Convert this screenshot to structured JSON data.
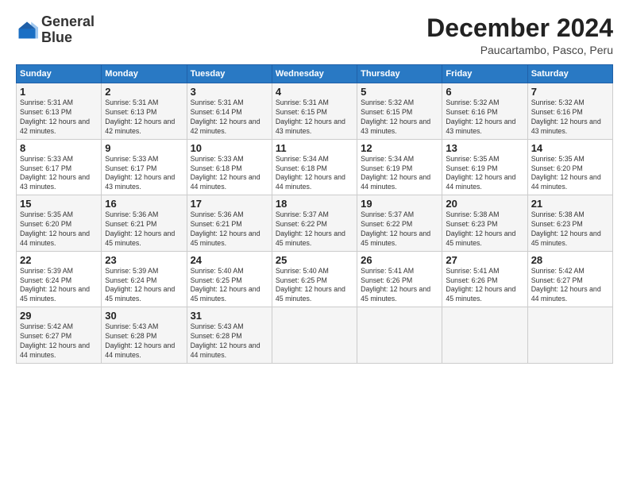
{
  "logo": {
    "line1": "General",
    "line2": "Blue"
  },
  "title": "December 2024",
  "subtitle": "Paucartambo, Pasco, Peru",
  "days_header": [
    "Sunday",
    "Monday",
    "Tuesday",
    "Wednesday",
    "Thursday",
    "Friday",
    "Saturday"
  ],
  "weeks": [
    [
      {
        "day": "1",
        "sunrise": "Sunrise: 5:31 AM",
        "sunset": "Sunset: 6:13 PM",
        "daylight": "Daylight: 12 hours and 42 minutes."
      },
      {
        "day": "2",
        "sunrise": "Sunrise: 5:31 AM",
        "sunset": "Sunset: 6:13 PM",
        "daylight": "Daylight: 12 hours and 42 minutes."
      },
      {
        "day": "3",
        "sunrise": "Sunrise: 5:31 AM",
        "sunset": "Sunset: 6:14 PM",
        "daylight": "Daylight: 12 hours and 42 minutes."
      },
      {
        "day": "4",
        "sunrise": "Sunrise: 5:31 AM",
        "sunset": "Sunset: 6:15 PM",
        "daylight": "Daylight: 12 hours and 43 minutes."
      },
      {
        "day": "5",
        "sunrise": "Sunrise: 5:32 AM",
        "sunset": "Sunset: 6:15 PM",
        "daylight": "Daylight: 12 hours and 43 minutes."
      },
      {
        "day": "6",
        "sunrise": "Sunrise: 5:32 AM",
        "sunset": "Sunset: 6:16 PM",
        "daylight": "Daylight: 12 hours and 43 minutes."
      },
      {
        "day": "7",
        "sunrise": "Sunrise: 5:32 AM",
        "sunset": "Sunset: 6:16 PM",
        "daylight": "Daylight: 12 hours and 43 minutes."
      }
    ],
    [
      {
        "day": "8",
        "sunrise": "Sunrise: 5:33 AM",
        "sunset": "Sunset: 6:17 PM",
        "daylight": "Daylight: 12 hours and 43 minutes."
      },
      {
        "day": "9",
        "sunrise": "Sunrise: 5:33 AM",
        "sunset": "Sunset: 6:17 PM",
        "daylight": "Daylight: 12 hours and 43 minutes."
      },
      {
        "day": "10",
        "sunrise": "Sunrise: 5:33 AM",
        "sunset": "Sunset: 6:18 PM",
        "daylight": "Daylight: 12 hours and 44 minutes."
      },
      {
        "day": "11",
        "sunrise": "Sunrise: 5:34 AM",
        "sunset": "Sunset: 6:18 PM",
        "daylight": "Daylight: 12 hours and 44 minutes."
      },
      {
        "day": "12",
        "sunrise": "Sunrise: 5:34 AM",
        "sunset": "Sunset: 6:19 PM",
        "daylight": "Daylight: 12 hours and 44 minutes."
      },
      {
        "day": "13",
        "sunrise": "Sunrise: 5:35 AM",
        "sunset": "Sunset: 6:19 PM",
        "daylight": "Daylight: 12 hours and 44 minutes."
      },
      {
        "day": "14",
        "sunrise": "Sunrise: 5:35 AM",
        "sunset": "Sunset: 6:20 PM",
        "daylight": "Daylight: 12 hours and 44 minutes."
      }
    ],
    [
      {
        "day": "15",
        "sunrise": "Sunrise: 5:35 AM",
        "sunset": "Sunset: 6:20 PM",
        "daylight": "Daylight: 12 hours and 44 minutes."
      },
      {
        "day": "16",
        "sunrise": "Sunrise: 5:36 AM",
        "sunset": "Sunset: 6:21 PM",
        "daylight": "Daylight: 12 hours and 45 minutes."
      },
      {
        "day": "17",
        "sunrise": "Sunrise: 5:36 AM",
        "sunset": "Sunset: 6:21 PM",
        "daylight": "Daylight: 12 hours and 45 minutes."
      },
      {
        "day": "18",
        "sunrise": "Sunrise: 5:37 AM",
        "sunset": "Sunset: 6:22 PM",
        "daylight": "Daylight: 12 hours and 45 minutes."
      },
      {
        "day": "19",
        "sunrise": "Sunrise: 5:37 AM",
        "sunset": "Sunset: 6:22 PM",
        "daylight": "Daylight: 12 hours and 45 minutes."
      },
      {
        "day": "20",
        "sunrise": "Sunrise: 5:38 AM",
        "sunset": "Sunset: 6:23 PM",
        "daylight": "Daylight: 12 hours and 45 minutes."
      },
      {
        "day": "21",
        "sunrise": "Sunrise: 5:38 AM",
        "sunset": "Sunset: 6:23 PM",
        "daylight": "Daylight: 12 hours and 45 minutes."
      }
    ],
    [
      {
        "day": "22",
        "sunrise": "Sunrise: 5:39 AM",
        "sunset": "Sunset: 6:24 PM",
        "daylight": "Daylight: 12 hours and 45 minutes."
      },
      {
        "day": "23",
        "sunrise": "Sunrise: 5:39 AM",
        "sunset": "Sunset: 6:24 PM",
        "daylight": "Daylight: 12 hours and 45 minutes."
      },
      {
        "day": "24",
        "sunrise": "Sunrise: 5:40 AM",
        "sunset": "Sunset: 6:25 PM",
        "daylight": "Daylight: 12 hours and 45 minutes."
      },
      {
        "day": "25",
        "sunrise": "Sunrise: 5:40 AM",
        "sunset": "Sunset: 6:25 PM",
        "daylight": "Daylight: 12 hours and 45 minutes."
      },
      {
        "day": "26",
        "sunrise": "Sunrise: 5:41 AM",
        "sunset": "Sunset: 6:26 PM",
        "daylight": "Daylight: 12 hours and 45 minutes."
      },
      {
        "day": "27",
        "sunrise": "Sunrise: 5:41 AM",
        "sunset": "Sunset: 6:26 PM",
        "daylight": "Daylight: 12 hours and 45 minutes."
      },
      {
        "day": "28",
        "sunrise": "Sunrise: 5:42 AM",
        "sunset": "Sunset: 6:27 PM",
        "daylight": "Daylight: 12 hours and 44 minutes."
      }
    ],
    [
      {
        "day": "29",
        "sunrise": "Sunrise: 5:42 AM",
        "sunset": "Sunset: 6:27 PM",
        "daylight": "Daylight: 12 hours and 44 minutes."
      },
      {
        "day": "30",
        "sunrise": "Sunrise: 5:43 AM",
        "sunset": "Sunset: 6:28 PM",
        "daylight": "Daylight: 12 hours and 44 minutes."
      },
      {
        "day": "31",
        "sunrise": "Sunrise: 5:43 AM",
        "sunset": "Sunset: 6:28 PM",
        "daylight": "Daylight: 12 hours and 44 minutes."
      },
      null,
      null,
      null,
      null
    ]
  ]
}
